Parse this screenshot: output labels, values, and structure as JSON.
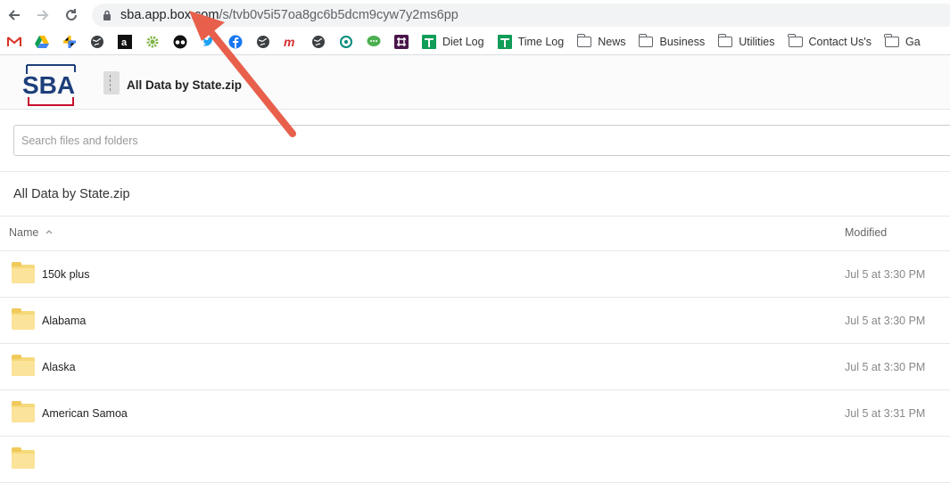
{
  "browser": {
    "url_host": "sba.app.box.com",
    "url_path": "/s/tvb0v5i57oa8gc6b5dcm9cyw7y2ms6pp"
  },
  "bookmarks": [
    {
      "icon": "gmail-icon",
      "label": ""
    },
    {
      "icon": "google-drive-icon",
      "label": ""
    },
    {
      "icon": "google-photos-icon",
      "label": ""
    },
    {
      "icon": "globe-icon",
      "label": ""
    },
    {
      "icon": "amazon-icon",
      "label": ""
    },
    {
      "icon": "gear-icon",
      "label": ""
    },
    {
      "icon": "tripadvisor-icon",
      "label": ""
    },
    {
      "icon": "twitter-icon",
      "label": ""
    },
    {
      "icon": "facebook-icon",
      "label": ""
    },
    {
      "icon": "globe-icon",
      "label": ""
    },
    {
      "icon": "m-icon",
      "label": ""
    },
    {
      "icon": "globe-icon",
      "label": ""
    },
    {
      "icon": "teal-icon",
      "label": ""
    },
    {
      "icon": "chat-icon",
      "label": ""
    },
    {
      "icon": "slack-icon",
      "label": ""
    },
    {
      "icon": "sheets-icon",
      "label": "Diet Log"
    },
    {
      "icon": "sheets-icon",
      "label": "Time Log"
    },
    {
      "icon": "folder-icon",
      "label": "News"
    },
    {
      "icon": "folder-icon",
      "label": "Business"
    },
    {
      "icon": "folder-icon",
      "label": "Utilities"
    },
    {
      "icon": "folder-icon",
      "label": "Contact Us's"
    },
    {
      "icon": "folder-icon",
      "label": "Ga"
    }
  ],
  "header": {
    "logo_text": "SBA",
    "file_name": "All Data by State.zip"
  },
  "search": {
    "placeholder": "Search files and folders"
  },
  "breadcrumb": "All Data by State.zip",
  "columns": {
    "name": "Name",
    "modified": "Modified"
  },
  "items": [
    {
      "name": "150k plus",
      "modified": "Jul 5 at 3:30 PM"
    },
    {
      "name": "Alabama",
      "modified": "Jul 5 at 3:30 PM"
    },
    {
      "name": "Alaska",
      "modified": "Jul 5 at 3:30 PM"
    },
    {
      "name": "American Samoa",
      "modified": "Jul 5 at 3:31 PM"
    }
  ],
  "colors": {
    "annotation_arrow": "#e8604c",
    "folder": "#f6d97a",
    "sba_blue": "#1d3f7a",
    "sba_red": "#c8102e"
  }
}
